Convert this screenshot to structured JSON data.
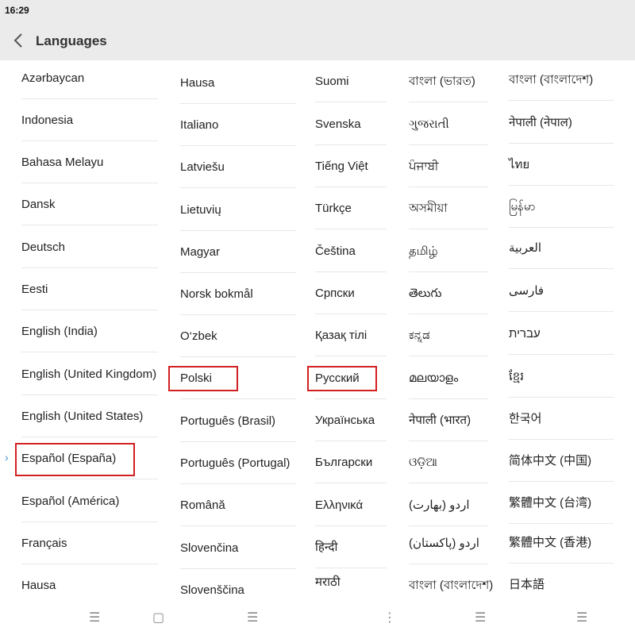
{
  "status_bar": {
    "time": "16:29"
  },
  "header": {
    "title": "Languages"
  },
  "columns": [
    {
      "items": [
        "Azərbaycan",
        "Indonesia",
        "Bahasa Melayu",
        "Dansk",
        "Deutsch",
        "Eesti",
        "English (India)",
        "English (United Kingdom)",
        "English (United States)",
        "Español (España)",
        "Español (América)",
        "Français",
        "Hausa"
      ]
    },
    {
      "items": [
        "Hausa",
        "Italiano",
        "Latviešu",
        "Lietuvių",
        "Magyar",
        "Norsk bokmål",
        "O‘zbek",
        "Polski",
        "Português (Brasil)",
        "Português (Portugal)",
        "Română",
        "Slovenčina",
        "Slovenščina"
      ]
    },
    {
      "items": [
        "Suomi",
        "Svenska",
        "Tiếng Việt",
        "Türkçe",
        "Čeština",
        "Српски",
        "Қазақ тілі",
        "Русский",
        "Українська",
        "Български",
        "Ελληνικά",
        "हिन्दी",
        "मराठी"
      ]
    },
    {
      "items": [
        "বাংলা (ভারত)",
        "ગુજરાતી",
        "ਪੰਜਾਬੀ",
        "অসমীয়া",
        "தமிழ்",
        "తెలుగు",
        "ಕನ್ನಡ",
        "മലയാളം",
        "नेपाली (भारत)",
        "ଓଡ଼ିଆ",
        "اردو (بھارت)",
        "اردو (پاکستان)",
        "বাংলা (বাংলাদেশ)"
      ]
    },
    {
      "items": [
        "বাংলা (বাংলাদেশ)",
        "नेपाली (नेपाल)",
        "ไทย",
        "မြန်မာ",
        "العربية",
        "فارسی",
        "עברית",
        "ខ្មែរ",
        "한국어",
        "简体中文 (中国)",
        "繁體中文 (台湾)",
        "繁體中文 (香港)",
        "日本語"
      ]
    }
  ],
  "selected_language": "Español (España)",
  "highlighted": [
    "Español (España)",
    "Polski",
    "Русский"
  ],
  "colors": {
    "highlight_border": "#d32020",
    "selected_arrow": "#3b8fd9",
    "header_bg": "#ebebeb"
  },
  "nav_bar": {
    "icons": [
      "menu-icon",
      "recent-apps-icon",
      "menu-icon",
      "more-icon",
      "menu-icon",
      "menu-icon"
    ]
  }
}
